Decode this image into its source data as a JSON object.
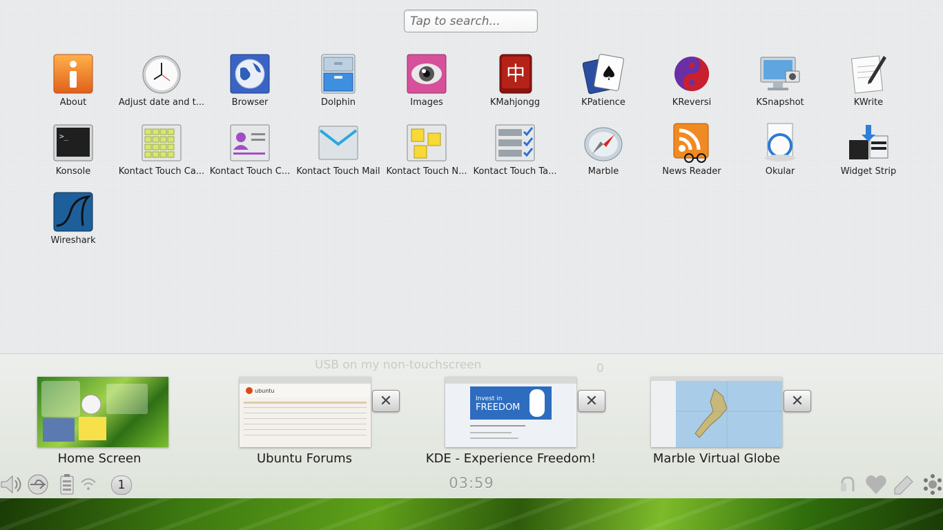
{
  "search": {
    "placeholder": "Tap to search..."
  },
  "apps": [
    {
      "label": "About",
      "icon": "info-icon"
    },
    {
      "label": "Adjust date and t...",
      "icon": "clock-icon"
    },
    {
      "label": "Browser",
      "icon": "globe-icon"
    },
    {
      "label": "Dolphin",
      "icon": "file-cabinet-icon"
    },
    {
      "label": "Images",
      "icon": "eye-icon"
    },
    {
      "label": "KMahjongg",
      "icon": "mahjong-tile-icon"
    },
    {
      "label": "KPatience",
      "icon": "playing-card-icon"
    },
    {
      "label": "KReversi",
      "icon": "reversi-icon"
    },
    {
      "label": "KSnapshot",
      "icon": "monitor-camera-icon"
    },
    {
      "label": "KWrite",
      "icon": "pencil-paper-icon"
    },
    {
      "label": "Konsole",
      "icon": "terminal-icon"
    },
    {
      "label": "Kontact Touch Ca...",
      "icon": "calendar-grid-icon"
    },
    {
      "label": "Kontact Touch C...",
      "icon": "contact-card-icon"
    },
    {
      "label": "Kontact Touch Mail",
      "icon": "envelope-icon"
    },
    {
      "label": "Kontact Touch N...",
      "icon": "sticky-notes-icon"
    },
    {
      "label": "Kontact Touch Ta...",
      "icon": "checklist-icon"
    },
    {
      "label": "Marble",
      "icon": "compass-globe-icon"
    },
    {
      "label": "News Reader",
      "icon": "rss-icon"
    },
    {
      "label": "Okular",
      "icon": "document-viewer-icon"
    },
    {
      "label": "Widget Strip",
      "icon": "widget-strip-icon"
    },
    {
      "label": "Wireshark",
      "icon": "shark-fin-icon"
    }
  ],
  "background_window": {
    "text": "USB on my non-touchscreen",
    "count": "0"
  },
  "tasks": [
    {
      "title": "Home Screen",
      "closable": false
    },
    {
      "title": "Ubuntu Forums",
      "closable": true
    },
    {
      "title": "KDE - Experience Freedom!",
      "closable": true
    },
    {
      "title": "Marble Virtual Globe",
      "closable": true
    }
  ],
  "system": {
    "clock": "03:59",
    "desktop_number": "1"
  },
  "thumb_text": {
    "ubuntu": "ubuntu",
    "kde_invest": "Invest in",
    "kde_freedom": "FREEDOM"
  },
  "colors": {
    "accent": "#3d7a10",
    "launcher_bg": "#eceeef"
  }
}
